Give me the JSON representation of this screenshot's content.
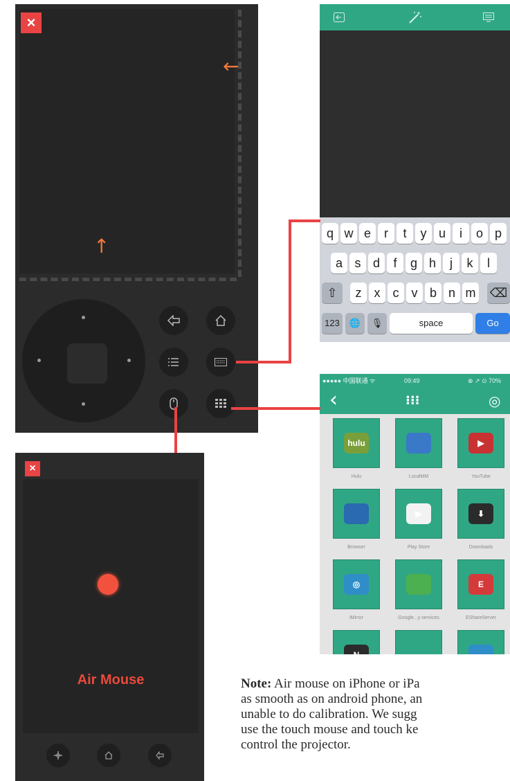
{
  "remote": {
    "close_label": "×",
    "arrow_up": "↑",
    "arrow_left": "←",
    "buttons": {
      "back_icon": "back-icon",
      "home_icon": "home-icon",
      "menu_icon": "menu-icon",
      "keyboard_icon": "keyboard-icon",
      "mouse_icon": "mouse-icon",
      "apps_icon": "apps-icon"
    }
  },
  "keyboard_screen": {
    "header_icons": [
      "input-icon",
      "magic-wand-icon",
      "screen-icon"
    ],
    "rows": [
      [
        "q",
        "w",
        "e",
        "r",
        "t",
        "y",
        "u",
        "i",
        "o",
        "p"
      ],
      [
        "a",
        "s",
        "d",
        "f",
        "g",
        "h",
        "j",
        "k",
        "l"
      ],
      [
        "z",
        "x",
        "c",
        "v",
        "b",
        "n",
        "m"
      ]
    ],
    "shift_label": "⇧",
    "delete_label": "⌫",
    "numbers_label": "123",
    "globe_label": "🌐",
    "mic_label": "🎙",
    "space_label": "space",
    "go_label": "Go"
  },
  "apps_screen": {
    "status": {
      "carrier": "●●●●● 中国联通 ᯤ",
      "time": "09:49",
      "battery": "⊕ ↗ ⊙ 70%"
    },
    "back_label": "‹",
    "grid_icon_label": "⁝⁝⁝",
    "tv_icon_label": "◎",
    "apps": [
      {
        "label": "Hulu",
        "icon": "hulu"
      },
      {
        "label": "LocalMM",
        "icon": ""
      },
      {
        "label": "YouTube",
        "icon": "▶"
      },
      {
        "label": "Browser",
        "icon": ""
      },
      {
        "label": "Play Store",
        "icon": "▶"
      },
      {
        "label": "Downloads",
        "icon": "⬇"
      },
      {
        "label": "iMirror",
        "icon": "◎"
      },
      {
        "label": "Google...y services",
        "icon": ""
      },
      {
        "label": "EShareServer",
        "icon": "E"
      },
      {
        "label": "",
        "icon": "N"
      },
      {
        "label": "",
        "icon": ""
      },
      {
        "label": "",
        "icon": ""
      }
    ]
  },
  "air_mouse": {
    "close_label": "×",
    "title": "Air Mouse"
  },
  "note": {
    "bold": "Note:",
    "line1": " Air mouse on iPhone or iPa",
    "line2": "as smooth as on android phone, an",
    "line3": "unable to do calibration. We sugg",
    "line4": "use the touch mouse and touch ke",
    "line5": "control the projector."
  },
  "colors": {
    "accent_red": "#e94343",
    "teal": "#2fa785",
    "orange": "#f0783a"
  }
}
